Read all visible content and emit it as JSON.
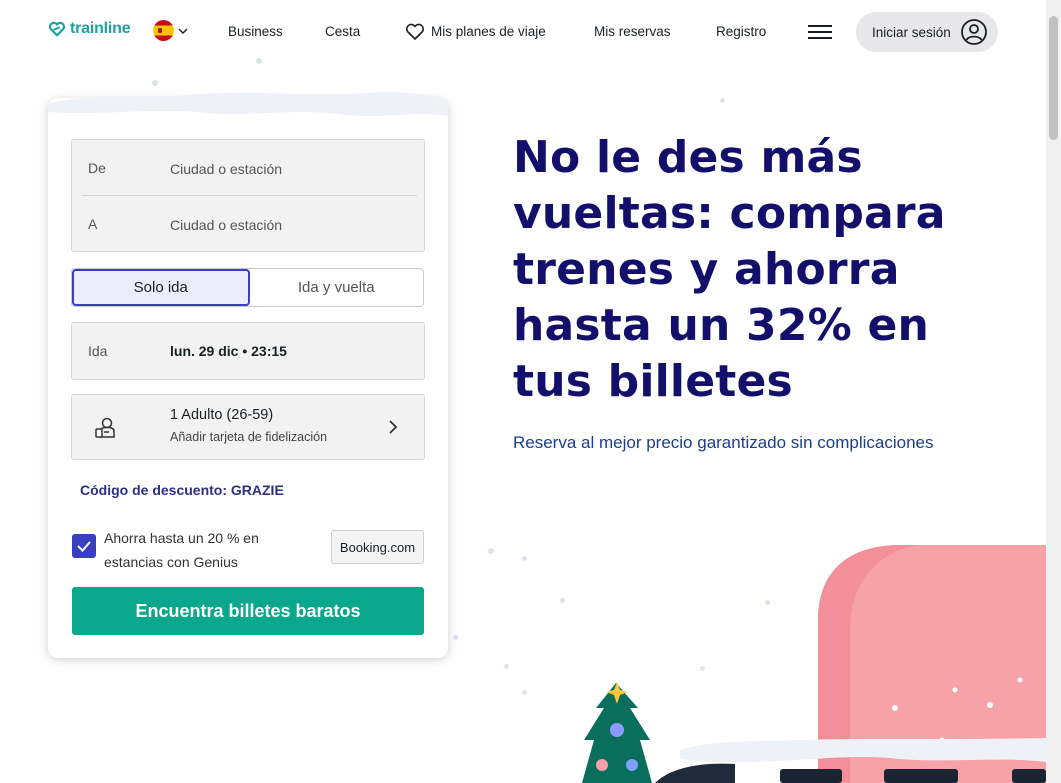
{
  "header": {
    "logo_text": "trainline",
    "nav": {
      "business": "Business",
      "cart": "Cesta",
      "travel_plans": "Mis planes de viaje",
      "bookings": "Mis reservas",
      "register": "Registro"
    },
    "login_label": "Iniciar sesión"
  },
  "search": {
    "from_label": "De",
    "from_placeholder": "Ciudad o estación",
    "to_label": "A",
    "to_placeholder": "Ciudad o estación",
    "trip_options": [
      "Solo ida",
      "Ida y vuelta"
    ],
    "selected_trip": "Solo ida",
    "date_label": "Ida",
    "date_value": "lun. 29 dic • 23:15",
    "passengers": "1 Adulto (26-59)",
    "loyalty_card": "Añadir tarjeta de fidelización",
    "promo_code": "Código de descuento: GRAZIE",
    "genius_text": "Ahorra hasta un 20 % en estancias con Genius",
    "genius_checked": true,
    "booking_badge": "Booking.com",
    "cta_label": "Encuentra billetes baratos"
  },
  "hero": {
    "title": "No le des más vueltas: compara trenes y ahorra hasta un 32% en tus billetes",
    "subtitle": "Reserva al mejor precio garantizado sin complicaciones"
  },
  "colors": {
    "brand": "#1ba3a0",
    "hero_title": "#13106b",
    "accent": "#3a3fc0",
    "cta": "#09a78b"
  }
}
